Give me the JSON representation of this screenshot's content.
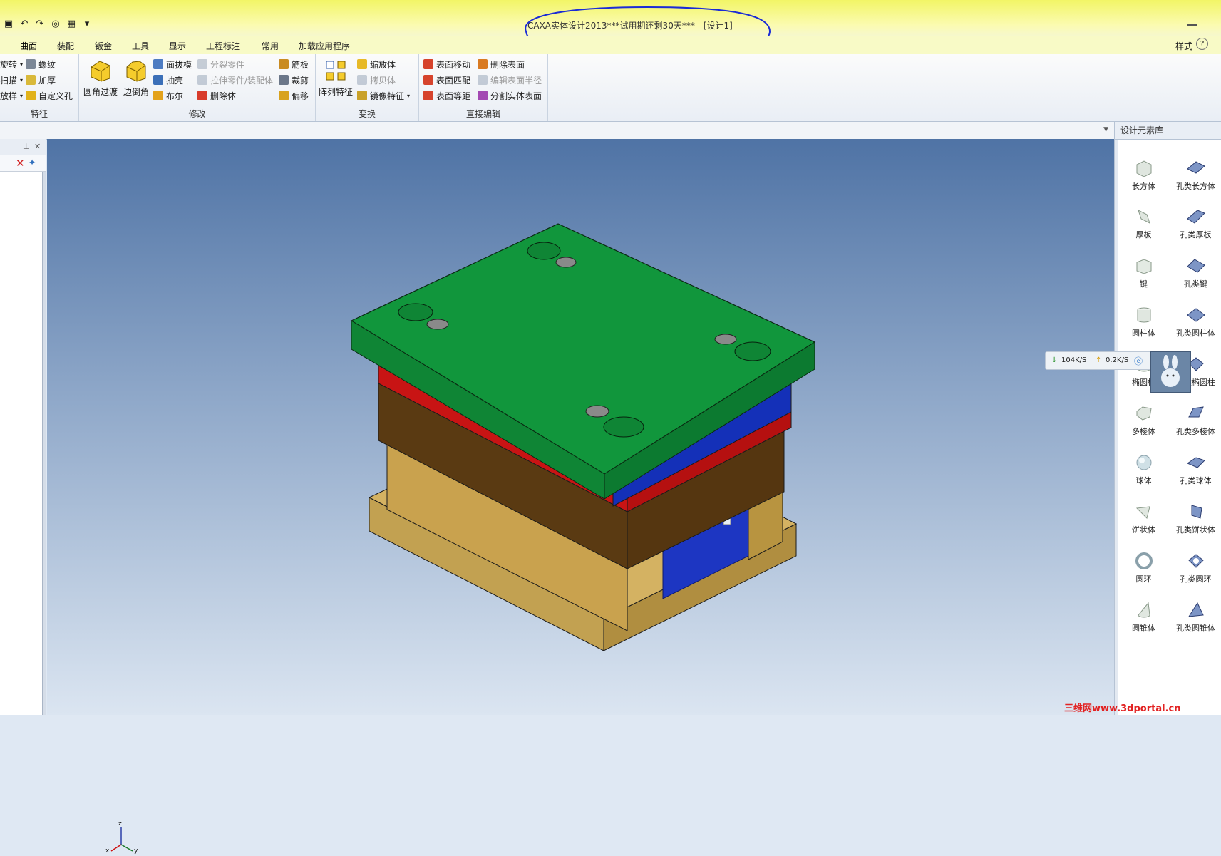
{
  "window": {
    "title": "CAXA实体设计2013***试用期还剩30天*** - [设计1]"
  },
  "ribbon_tabs": [
    "曲面",
    "装配",
    "钣金",
    "工具",
    "显示",
    "工程标注",
    "常用",
    "加载应用程序"
  ],
  "tabs_right": {
    "style_label": "样式",
    "help": "?"
  },
  "groups": {
    "feature": {
      "label": "特征",
      "items": [
        "旋转",
        "扫描",
        "放样",
        "螺纹",
        "加厚",
        "自定义孔"
      ]
    },
    "modify": {
      "label": "修改",
      "big": [
        "圆角过渡",
        "边倒角"
      ],
      "items": [
        "面拔模",
        "抽壳",
        "布尔",
        "分裂零件",
        "拉伸零件/装配体",
        "删除体",
        "筋板",
        "裁剪",
        "偏移"
      ]
    },
    "transform": {
      "label": "变换",
      "big": [
        "阵列特征"
      ],
      "items": [
        "缩放体",
        "拷贝体",
        "镜像特征"
      ]
    },
    "direct_edit": {
      "label": "直接编辑",
      "items": [
        "表面移动",
        "表面匹配",
        "表面等距",
        "删除表面",
        "编辑表面半径",
        "分割实体表面"
      ]
    }
  },
  "design_library": {
    "title": "设计元素库",
    "items": [
      "长方体",
      "孔类长方体",
      "厚板",
      "孔类厚板",
      "键",
      "孔类键",
      "圆柱体",
      "孔类圆柱体",
      "椭圆柱",
      "孔类椭圆柱",
      "多棱体",
      "孔类多棱体",
      "球体",
      "孔类球体",
      "饼状体",
      "孔类饼状体",
      "圆环",
      "孔类圆环",
      "圆锥体",
      "孔类圆锥体"
    ]
  },
  "network": {
    "down": "104K/S",
    "up": "0.2K/S"
  },
  "axes": {
    "z": "z",
    "x": "x",
    "y": "y"
  },
  "watermark": "三维网www.3dportal.cn",
  "colors": {
    "top_plate": "#11963c",
    "red_plate": "#c81414",
    "brown_plate": "#5a3a12",
    "blue_plate": "#1430b8",
    "tan_body": "#c9a24e",
    "title_bar": "#f2f566"
  }
}
